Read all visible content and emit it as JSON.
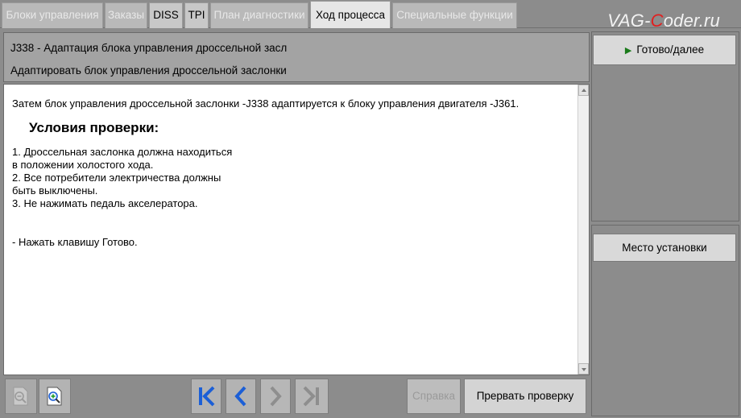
{
  "tabs": [
    {
      "label": "Блоки управления",
      "state": "disabled"
    },
    {
      "label": "Заказы",
      "state": "disabled"
    },
    {
      "label": "DISS",
      "state": "enabled"
    },
    {
      "label": "TPI",
      "state": "enabled"
    },
    {
      "label": "План диагностики",
      "state": "disabled"
    },
    {
      "label": "Ход процесса",
      "state": "active"
    },
    {
      "label": "Специальные функции",
      "state": "disabled"
    }
  ],
  "watermark": {
    "prefix": "VAG-",
    "c": "C",
    "suffix": "oder.ru"
  },
  "header": {
    "line1": "J338 - Адаптация блока управления дроссельной засл",
    "line2": "Адаптировать блок управления дроссельной заслонки"
  },
  "content": {
    "intro": "Затем блок управления дроссельной заслонки -J338 адаптируется к блоку управления двигателя -J361.",
    "heading": "Условия проверки:",
    "conditions": [
      "1. Дроссельная заслонка должна находиться",
      "в положении холостого хода.",
      "2. Все потребители электричества  должны",
      "быть выключены.",
      "3. Не нажимать педаль акселератора."
    ],
    "instruction": "- Нажать клавишу Готово."
  },
  "right_panel": {
    "ready_label": "Готово/далее",
    "place_label": "Место установки"
  },
  "toolbar": {
    "help_label": "Справка",
    "abort_label": "Прервать проверку"
  },
  "icons": {
    "zoom_out": "zoom-out-icon",
    "zoom_in": "zoom-in-icon",
    "first": "first-page-icon",
    "prev": "prev-icon",
    "next": "next-icon",
    "last": "last-page-icon"
  },
  "colors": {
    "accent_blue": "#1c5fd6",
    "play_green": "#1a7a1a",
    "watermark_red": "#e02020"
  }
}
